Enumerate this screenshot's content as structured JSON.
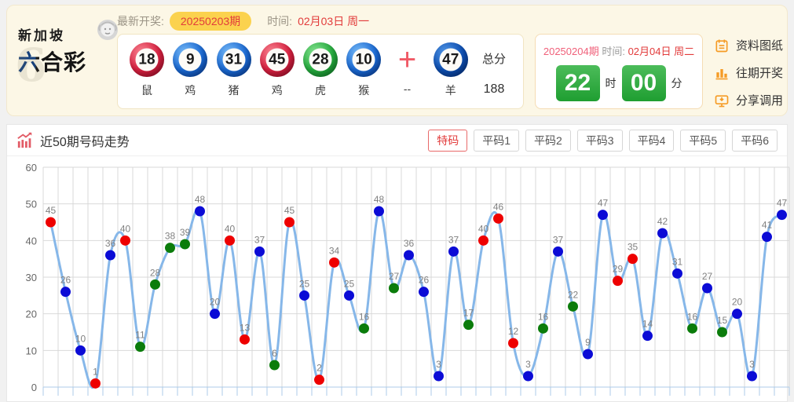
{
  "header": {
    "logo_line1": "新加坡",
    "logo_line2": "六合彩",
    "latest_label": "最新开奖:",
    "issue_pill": "20250203期",
    "time_label": "时间:",
    "time_value": "02月03日 周一",
    "balls": [
      {
        "num": "18",
        "zodiac": "鼠",
        "color": "red"
      },
      {
        "num": "9",
        "zodiac": "鸡",
        "color": "blue"
      },
      {
        "num": "31",
        "zodiac": "猪",
        "color": "blue"
      },
      {
        "num": "45",
        "zodiac": "鸡",
        "color": "red"
      },
      {
        "num": "28",
        "zodiac": "虎",
        "color": "green"
      },
      {
        "num": "10",
        "zodiac": "猴",
        "color": "blue"
      },
      {
        "num": "47",
        "zodiac": "羊",
        "color": "navy"
      }
    ],
    "plus_sign": "+",
    "plus_sub": "--",
    "total_label": "总分",
    "total_value": "188"
  },
  "countdown": {
    "issue": "20250204期",
    "time_label": "时间:",
    "time_value": "02月04日 周二",
    "hours": "22",
    "hour_unit": "时",
    "minutes": "00",
    "minute_unit": "分"
  },
  "side_buttons": [
    {
      "icon": "notebook-icon",
      "label": "资料图纸"
    },
    {
      "icon": "bar-chart-icon",
      "label": "往期开奖"
    },
    {
      "icon": "share-icon",
      "label": "分享调用"
    }
  ],
  "trend": {
    "title": "近50期号码走势",
    "tabs": [
      {
        "label": "特码",
        "active": true
      },
      {
        "label": "平码1",
        "active": false
      },
      {
        "label": "平码2",
        "active": false
      },
      {
        "label": "平码3",
        "active": false
      },
      {
        "label": "平码4",
        "active": false
      },
      {
        "label": "平码5",
        "active": false
      },
      {
        "label": "平码6",
        "active": false
      }
    ]
  },
  "chart_data": {
    "type": "line",
    "title": "近50期号码走势",
    "values": [
      45,
      26,
      10,
      1,
      36,
      40,
      11,
      28,
      38,
      39,
      48,
      20,
      40,
      13,
      37,
      6,
      45,
      25,
      2,
      34,
      25,
      16,
      48,
      27,
      36,
      26,
      3,
      37,
      17,
      40,
      46,
      12,
      3,
      16,
      37,
      22,
      9,
      47,
      29,
      35,
      14,
      42,
      31,
      16,
      27,
      15,
      20,
      3,
      41,
      47
    ],
    "point_color_names": [
      "red",
      "blue",
      "blue",
      "red",
      "blue",
      "red",
      "green",
      "green",
      "green",
      "green",
      "blue",
      "blue",
      "red",
      "red",
      "blue",
      "green",
      "red",
      "blue",
      "red",
      "red",
      "blue",
      "green",
      "blue",
      "green",
      "blue",
      "blue",
      "blue",
      "blue",
      "green",
      "red",
      "red",
      "red",
      "blue",
      "green",
      "blue",
      "green",
      "blue",
      "blue",
      "red",
      "red",
      "blue",
      "blue",
      "blue",
      "green",
      "blue",
      "green",
      "blue",
      "blue",
      "blue",
      "blue"
    ],
    "ylim": [
      0,
      60
    ],
    "yticks": [
      0,
      10,
      20,
      30,
      40,
      50,
      60
    ],
    "grid": true,
    "legend": "none",
    "line_color": "#86b7e9",
    "grid_color": "#d9d9d9",
    "axis_tick_color": "#aecbe8",
    "label_color": "#808080",
    "point_colors": {
      "red": "#ee0000",
      "blue": "#0b0bd6",
      "green": "#0b7c0b"
    }
  }
}
